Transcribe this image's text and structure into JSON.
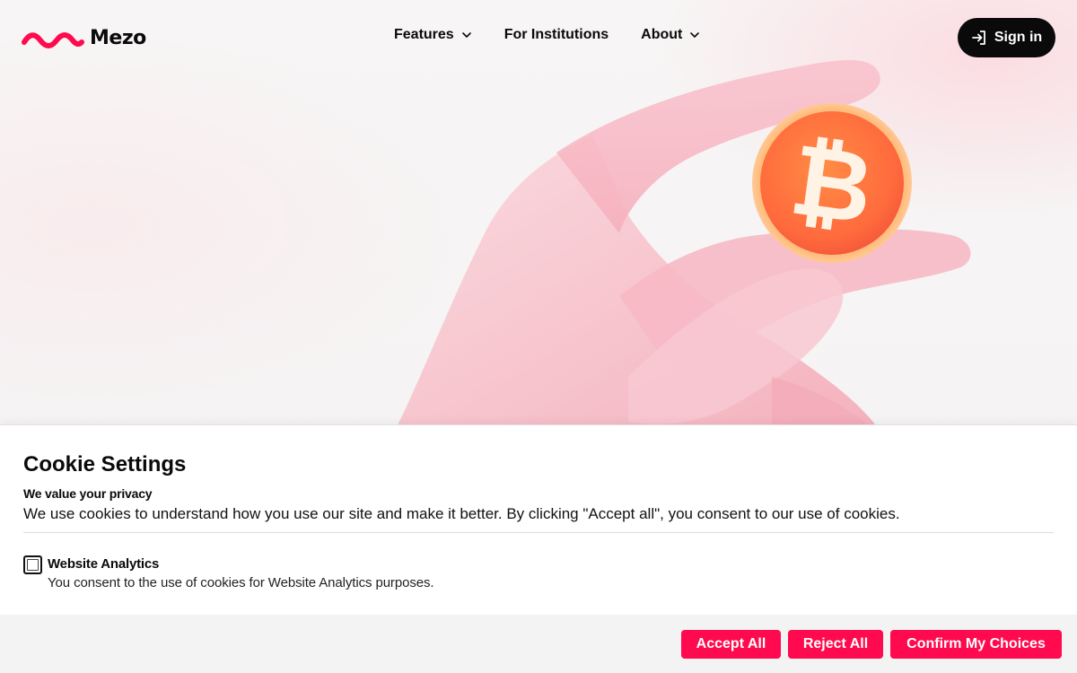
{
  "brand": {
    "name": "Mezo",
    "logo_icon": "wave-logo-icon",
    "accent_color": "#ff0a4e"
  },
  "nav": {
    "items": [
      {
        "label": "Features",
        "has_dropdown": true,
        "icon": "chevron-down-icon"
      },
      {
        "label": "For Institutions",
        "has_dropdown": false
      },
      {
        "label": "About",
        "has_dropdown": true,
        "icon": "chevron-down-icon"
      }
    ],
    "signin_label": "Sign in",
    "signin_icon": "sign-in-icon"
  },
  "hero": {
    "image": "hand-holding-bitcoin-illustration",
    "coin_icon": "bitcoin-icon"
  },
  "cookie": {
    "title": "Cookie Settings",
    "subtitle": "We value your privacy",
    "description": "We use cookies to understand how you use our site and make it better. By clicking \"Accept all\", you consent to our use of cookies.",
    "options": [
      {
        "label": "Website Analytics",
        "description": "You consent to the use of cookies for Website Analytics purposes.",
        "checked": false
      }
    ],
    "buttons": {
      "accept": "Accept All",
      "reject": "Reject All",
      "confirm": "Confirm My Choices"
    }
  }
}
